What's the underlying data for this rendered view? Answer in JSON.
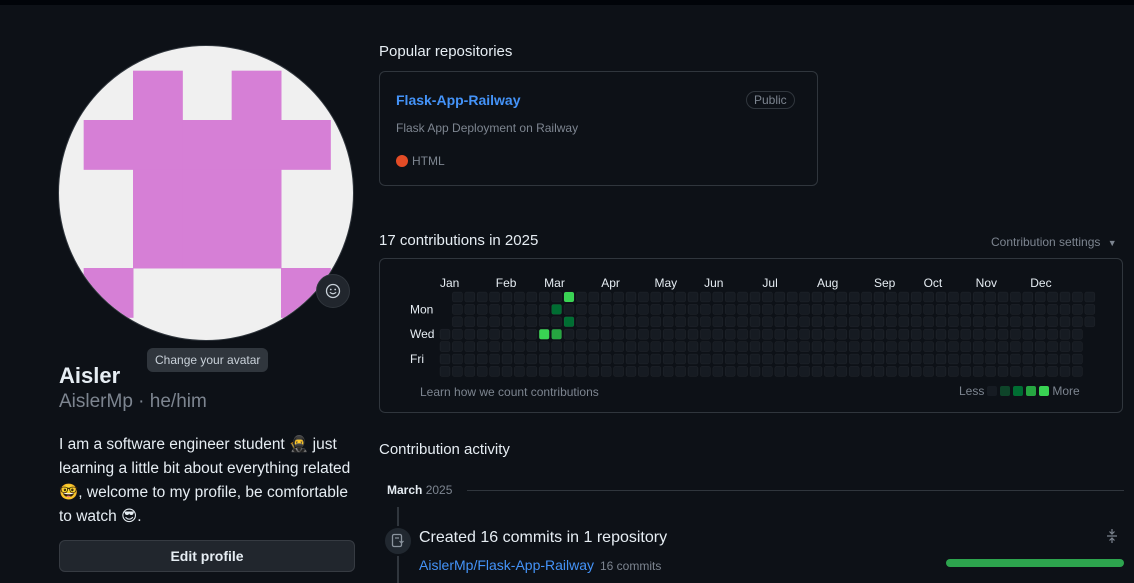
{
  "profile": {
    "fullname": "Aisler",
    "username_line": "AislerMp · he/him",
    "bio": "I am a software engineer student 🥷 just learning a little bit about everything related 🤓, welcome to my profile, be comfortable to watch 😎.",
    "avatar_tooltip": "Change your avatar",
    "edit_button": "Edit profile",
    "avatar_color": "#d67fd6"
  },
  "popular": {
    "title": "Popular repositories",
    "repos": [
      {
        "name": "Flask-App-Railway",
        "visibility": "Public",
        "description": "Flask App Deployment on Railway",
        "language": "HTML",
        "language_color": "#e34c26"
      }
    ]
  },
  "contributions": {
    "title": "17 contributions in 2025",
    "settings_label": "Contribution settings",
    "months": [
      "Jan",
      "Feb",
      "Mar",
      "Apr",
      "May",
      "Jun",
      "Jul",
      "Aug",
      "Sep",
      "Oct",
      "Nov",
      "Dec"
    ],
    "days": [
      "Mon",
      "Wed",
      "Fri"
    ],
    "learn_link": "Learn how we count contributions",
    "legend_less": "Less",
    "legend_more": "More",
    "levels": [
      "#161b22",
      "#0e4429",
      "#006d32",
      "#26a641",
      "#39d353"
    ],
    "active_cells": [
      {
        "week": 10,
        "day": 0,
        "level": 4
      },
      {
        "week": 9,
        "day": 1,
        "level": 2
      },
      {
        "week": 10,
        "day": 2,
        "level": 2
      },
      {
        "week": 8,
        "day": 3,
        "level": 4
      },
      {
        "week": 9,
        "day": 3,
        "level": 3
      }
    ]
  },
  "activity": {
    "title": "Contribution activity",
    "month": "March",
    "year": "2025",
    "commit_title": "Created 16 commits in 1 repository",
    "commit_repo": "AislerMp/Flask-App-Railway",
    "commit_count": "16 commits"
  }
}
